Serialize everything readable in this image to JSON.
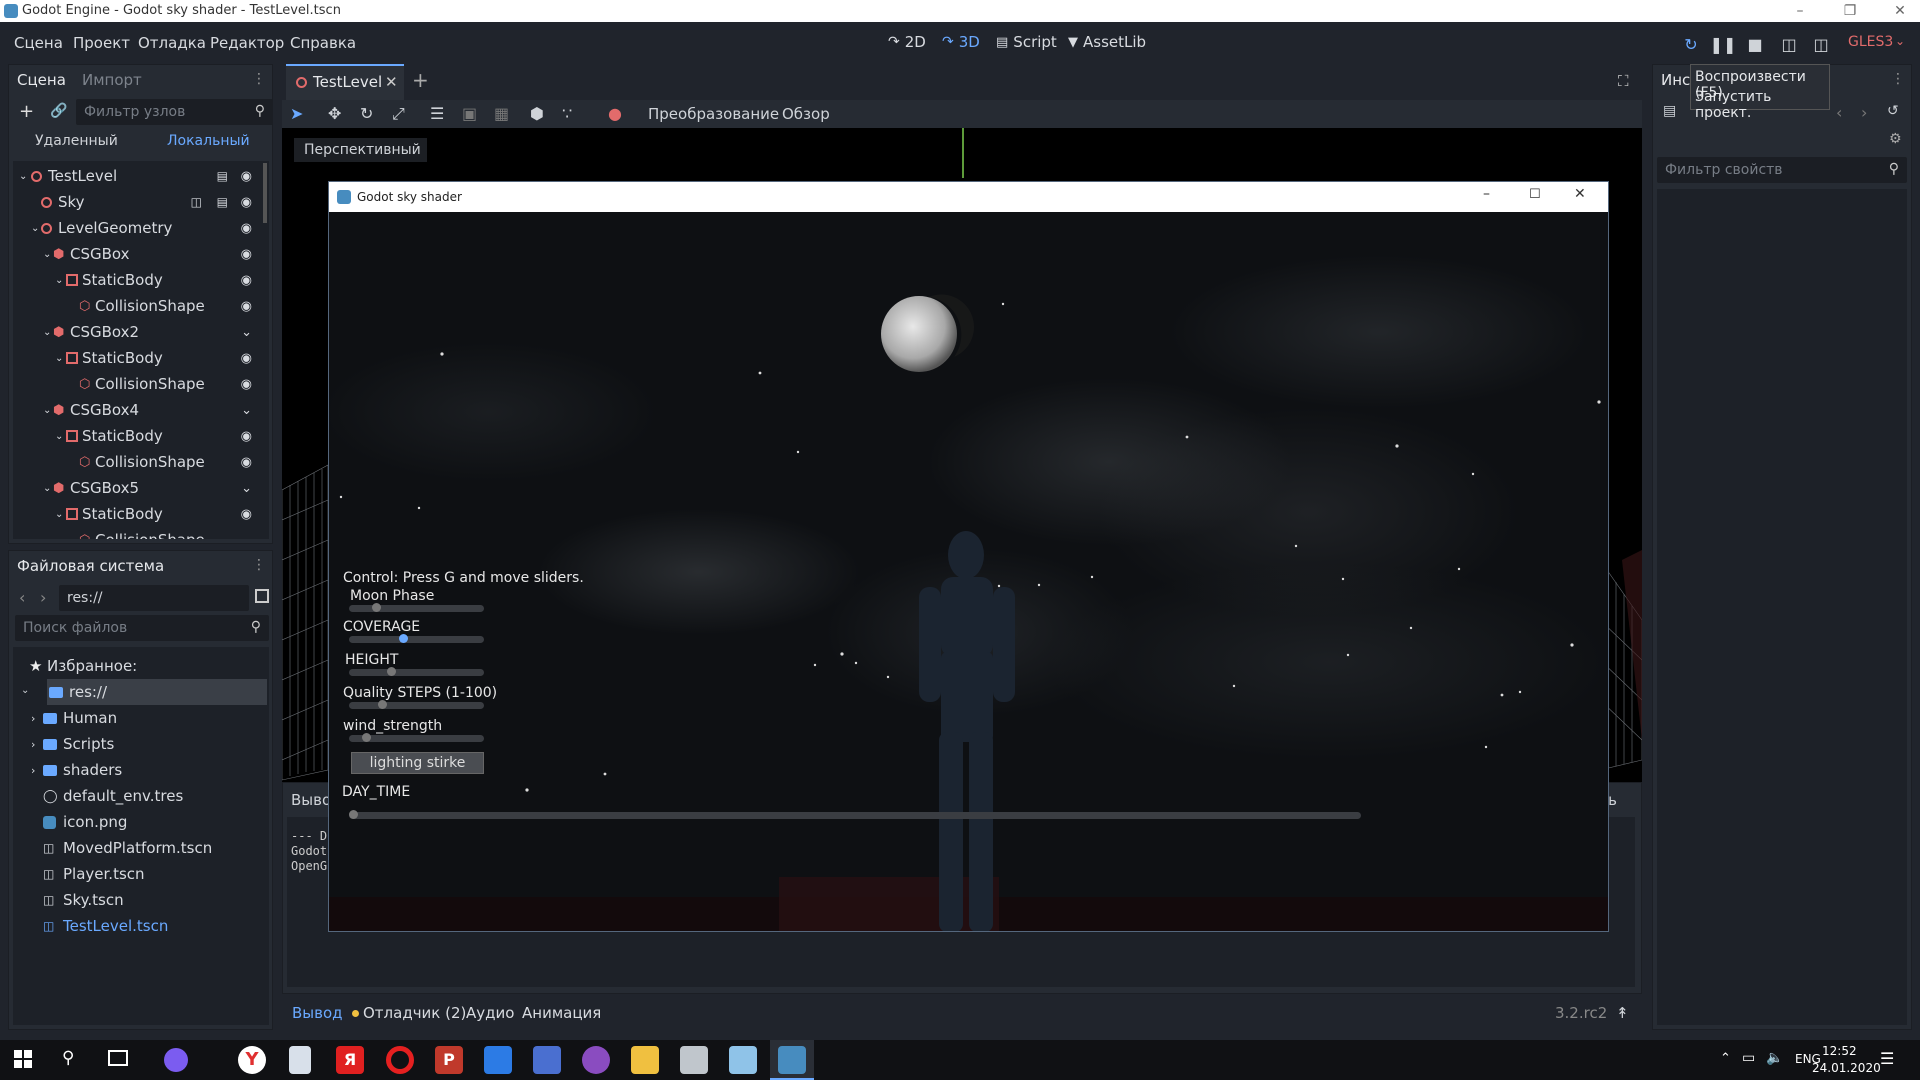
{
  "window": {
    "title": "Godot Engine - Godot sky shader - TestLevel.tscn"
  },
  "menu": [
    "Сцена",
    "Проект",
    "Отладка",
    "Редактор",
    "Справка"
  ],
  "modes": {
    "m2d": "2D",
    "m3d": "3D",
    "script": "Script",
    "assetlib": "AssetLib"
  },
  "renderer": "GLES3",
  "tooltip": {
    "line1": "Воспроизвести (F5)",
    "line2": "Запустить проект."
  },
  "scene_panel": {
    "tab_scene": "Сцена",
    "tab_import": "Импорт",
    "filter_placeholder": "Фильтр узлов",
    "remote": "Удаленный",
    "local": "Локальный",
    "nodes": [
      "TestLevel",
      "Sky",
      "LevelGeometry",
      "CSGBox",
      "StaticBody",
      "CollisionShape",
      "CSGBox2",
      "StaticBody",
      "CollisionShape",
      "CSGBox4",
      "StaticBody",
      "CollisionShape",
      "CSGBox5",
      "StaticBody",
      "CollisionShape"
    ]
  },
  "filesystem": {
    "title": "Файловая система",
    "path": "res://",
    "search_placeholder": "Поиск файлов",
    "favorites": "Избранное:",
    "items": [
      "res://",
      "Human",
      "Scripts",
      "shaders",
      "default_env.tres",
      "icon.png",
      "MovedPlatform.tscn",
      "Player.tscn",
      "Sky.tscn",
      "TestLevel.tscn"
    ]
  },
  "editor": {
    "tab": "TestLevel",
    "transform": "Преобразование",
    "view": "Обзор",
    "perspective": "Перспективный"
  },
  "inspector": {
    "tab": "Инс",
    "filter_placeholder": "Фильтр свойств"
  },
  "game": {
    "title": "Godot sky shader",
    "control": "Control: Press G and move sliders.",
    "labels": {
      "moon": "Moon Phase",
      "coverage": "COVERAGE",
      "height": "HEIGHT",
      "quality": "Quality STEPS (1-100)",
      "wind": "wind_strength",
      "daytime": "DAY_TIME"
    },
    "button": "lighting stirke",
    "sliders": {
      "moon": 0.18,
      "coverage": 0.4,
      "height": 0.3,
      "quality": 0.23,
      "wind": 0.1,
      "daytime": 0.0
    }
  },
  "output": {
    "header": "Выво",
    "right": "ить",
    "lines": [
      "--- D",
      "Godot",
      "OpenG"
    ]
  },
  "bottom_tabs": {
    "output": "Вывод",
    "debugger": "Отладчик (2)",
    "audio": "Аудио",
    "animation": "Анимация",
    "version": "3.2.rc2"
  },
  "taskbar": {
    "lang": "ENG",
    "time": "12:52",
    "date": "24.01.2020"
  }
}
